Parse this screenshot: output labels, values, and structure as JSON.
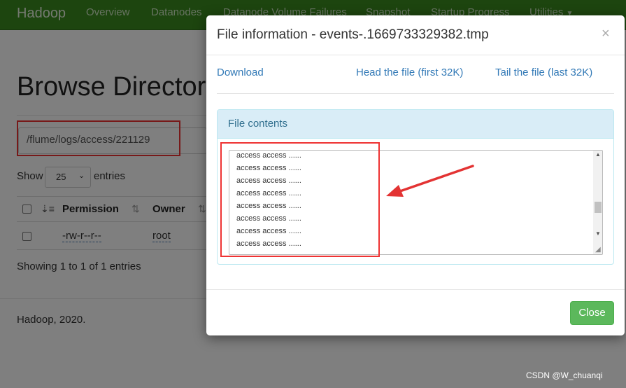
{
  "navbar": {
    "brand": "Hadoop",
    "items": [
      "Overview",
      "Datanodes",
      "Datanode Volume Failures",
      "Snapshot",
      "Startup Progress",
      "Utilities"
    ]
  },
  "page": {
    "title": "Browse Director",
    "path": "/flume/logs/access/221129",
    "show_label": "Show",
    "page_size": "25",
    "entries_label": "entries",
    "columns": [
      "Permission",
      "Owner"
    ],
    "row": {
      "permission": "-rw-r--r--",
      "owner": "root"
    },
    "showing": "Showing 1 to 1 of 1 entries",
    "footer": "Hadoop, 2020."
  },
  "modal": {
    "title": "File information - events-.1669733329382.tmp",
    "close_icon": "×",
    "links": {
      "download": "Download",
      "head": "Head the file (first 32K)",
      "tail": "Tail the file (last 32K)"
    },
    "panel_title": "File contents",
    "lines": [
      "access access ......",
      "access access ......",
      "access access ......",
      "access access ......",
      "access access ......",
      "access access ......",
      "access access ......",
      "access access ......"
    ],
    "close_button": "Close"
  },
  "watermark": "CSDN @W_chuanqi",
  "colors": {
    "navbar": "#3a8a1f",
    "annotation_red": "#e33333",
    "close_button": "#5cb85c",
    "link": "#337ab7"
  }
}
